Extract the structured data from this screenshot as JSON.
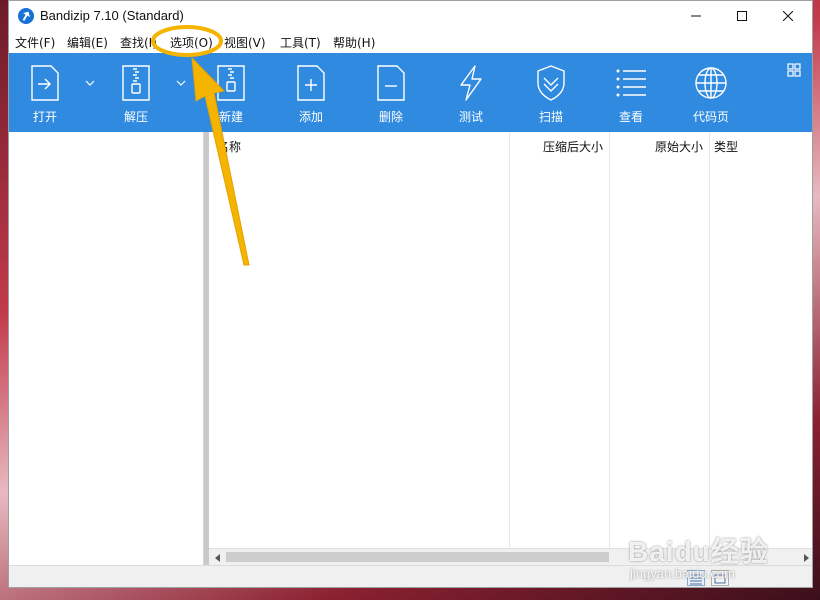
{
  "window": {
    "title": "Bandizip 7.10 (Standard)",
    "controls": {
      "minimize": "minimize-icon",
      "maximize": "maximize-icon",
      "close": "close-icon"
    }
  },
  "menu": [
    {
      "label": "文件(F)"
    },
    {
      "label": "编辑(E)"
    },
    {
      "label": "查找(I)"
    },
    {
      "label": "选项(O)"
    },
    {
      "label": "视图(V)"
    },
    {
      "label": "工具(T)"
    },
    {
      "label": "帮助(H)"
    }
  ],
  "toolbar": {
    "items": [
      {
        "label": "打开",
        "icon": "open-archive-icon",
        "has_dropdown": true
      },
      {
        "label": "解压",
        "icon": "extract-zipper-icon",
        "has_dropdown": true
      },
      {
        "label": "新建",
        "icon": "new-archive-icon",
        "has_dropdown": false
      },
      {
        "label": "添加",
        "icon": "add-file-icon",
        "has_dropdown": false
      },
      {
        "label": "删除",
        "icon": "delete-file-icon",
        "has_dropdown": false
      },
      {
        "label": "测试",
        "icon": "lightning-icon",
        "has_dropdown": false
      },
      {
        "label": "扫描",
        "icon": "shield-scan-icon",
        "has_dropdown": false
      },
      {
        "label": "查看",
        "icon": "list-view-icon",
        "has_dropdown": false
      },
      {
        "label": "代码页",
        "icon": "globe-icon",
        "has_dropdown": false
      }
    ],
    "color": "#2f8ae0"
  },
  "filelist": {
    "columns": [
      {
        "label": "名称"
      },
      {
        "label": "压缩后大小"
      },
      {
        "label": "原始大小"
      },
      {
        "label": "类型"
      }
    ]
  },
  "annotation": {
    "highlight_target": "选项(O)",
    "color": "#f5b400"
  },
  "watermark": {
    "brand": "Baidu经验",
    "site": "jingyan.baidu.com"
  }
}
